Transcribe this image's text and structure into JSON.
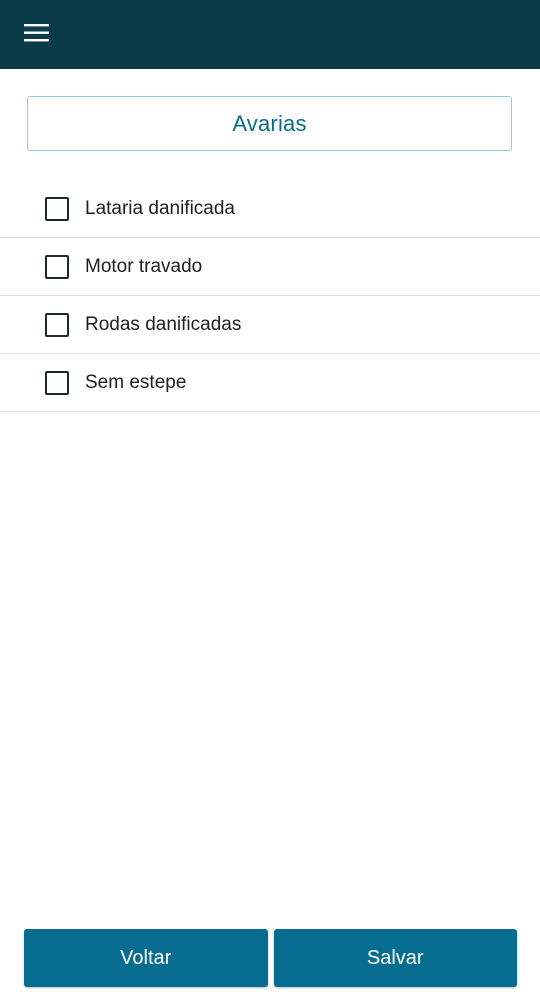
{
  "header": {
    "menu_icon": "hamburger-menu-icon",
    "background_color": "#0b3a48"
  },
  "title": "Avarias",
  "checklist": [
    {
      "label": "Lataria danificada",
      "checked": false
    },
    {
      "label": "Motor travado",
      "checked": false
    },
    {
      "label": "Rodas danificadas",
      "checked": false
    },
    {
      "label": "Sem estepe",
      "checked": false
    }
  ],
  "footer": {
    "back_label": "Voltar",
    "save_label": "Salvar",
    "button_color": "#066d91"
  }
}
